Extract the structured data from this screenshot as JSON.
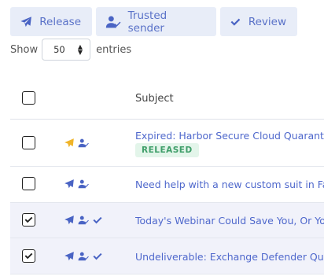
{
  "toolbar": {
    "release_label": "Release",
    "trusted_label": "Trusted sender",
    "review_label": "Review"
  },
  "entries": {
    "show_label": "Show",
    "page_size": "50",
    "entries_label": "entries"
  },
  "table": {
    "subject_header": "Subject",
    "rows": [
      {
        "subject": "Expired: Harbor Secure Cloud Quarantine",
        "badge": "RELEASED",
        "checked": false,
        "icons": [
          "release-icon-highlighted",
          "trusted-sender-icon"
        ]
      },
      {
        "subject": "Need help with a new custom suit in Fall",
        "checked": false,
        "icons": [
          "release-icon",
          "trusted-sender-icon"
        ]
      },
      {
        "subject": "Today's Webinar Could Save You, Or Your",
        "checked": true,
        "icons": [
          "release-icon",
          "trusted-sender-icon",
          "review-icon"
        ]
      },
      {
        "subject": "Undeliverable: Exchange Defender Quarantine",
        "checked": true,
        "icons": [
          "release-icon",
          "trusted-sender-icon",
          "review-icon"
        ]
      }
    ]
  },
  "colors": {
    "accent": "#4a64c4",
    "released_badge_bg": "#e3f5ea",
    "released_badge_text": "#3f9e69",
    "highlight_icon": "#f0b429"
  }
}
